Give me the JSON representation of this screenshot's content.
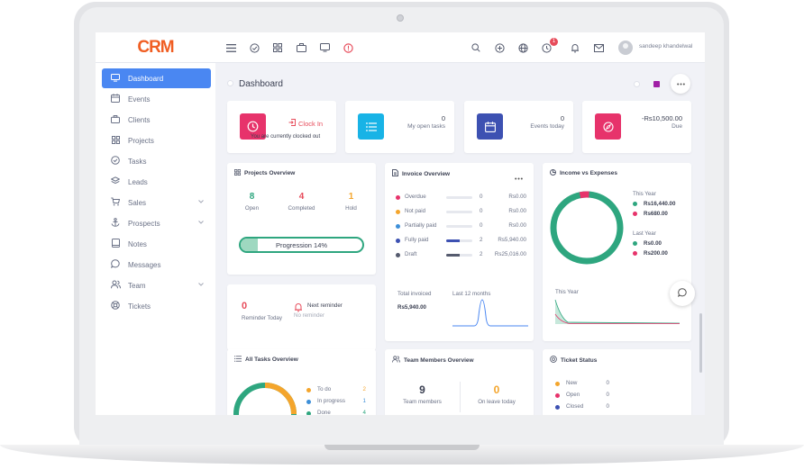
{
  "colors": {
    "accent": "#4a87f2",
    "brand": "#f05e23",
    "pink": "#e7336b",
    "cyan": "#18b3e6",
    "indigo": "#3d51b2",
    "green": "#2ea67f",
    "orange": "#f4a52c",
    "red": "#e74c5b"
  },
  "topbar": {
    "logo": "CRM",
    "icons": [
      "menu-icon",
      "check-circle-icon",
      "grid-icon",
      "briefcase-icon",
      "monitor-icon",
      "alert-icon"
    ],
    "right_icons": [
      "search-icon",
      "plus-circle-icon",
      "globe-icon",
      "clock-icon",
      "bell-icon",
      "mail-icon"
    ],
    "notification_count": "1",
    "user_name": "sandeep khandelwal"
  },
  "sidebar": {
    "items": [
      {
        "label": "Dashboard",
        "icon": "monitor-icon",
        "active": true
      },
      {
        "label": "Events",
        "icon": "calendar-icon"
      },
      {
        "label": "Clients",
        "icon": "briefcase-icon"
      },
      {
        "label": "Projects",
        "icon": "grid-icon"
      },
      {
        "label": "Tasks",
        "icon": "check-circle-icon"
      },
      {
        "label": "Leads",
        "icon": "layers-icon"
      },
      {
        "label": "Sales",
        "icon": "cart-icon",
        "expandable": true
      },
      {
        "label": "Prospects",
        "icon": "anchor-icon",
        "expandable": true
      },
      {
        "label": "Notes",
        "icon": "book-icon"
      },
      {
        "label": "Messages",
        "icon": "message-icon"
      },
      {
        "label": "Team",
        "icon": "users-icon",
        "expandable": true
      },
      {
        "label": "Tickets",
        "icon": "lifebuoy-icon"
      }
    ]
  },
  "page": {
    "title": "Dashboard"
  },
  "tiles": {
    "clock": {
      "action": "Clock In",
      "status": "You are currently clocked out"
    },
    "tasks": {
      "value": "0",
      "label": "My open tasks"
    },
    "events": {
      "value": "0",
      "label": "Events today"
    },
    "due": {
      "value": "-Rs10,500.00",
      "label": "Due"
    }
  },
  "projects_overview": {
    "title": "Projects Overview",
    "stats": [
      {
        "value": "8",
        "label": "Open",
        "color": "#2ea67f"
      },
      {
        "value": "4",
        "label": "Completed",
        "color": "#e74c5b"
      },
      {
        "value": "1",
        "label": "Hold",
        "color": "#f4a52c"
      }
    ],
    "progression_label": "Progression 14%",
    "progression": 0.14
  },
  "reminder": {
    "value": "0",
    "label": "Reminder Today",
    "next_title": "Next reminder",
    "next_value": "No reminder"
  },
  "invoice_overview": {
    "title": "Invoice Overview",
    "rows": [
      {
        "label": "Overdue",
        "count": "0",
        "amount": "Rs0.00",
        "color": "#e7336b",
        "fill": 0
      },
      {
        "label": "Not paid",
        "count": "0",
        "amount": "Rs0.00",
        "color": "#f4a52c",
        "fill": 0
      },
      {
        "label": "Partially paid",
        "count": "0",
        "amount": "Rs0.00",
        "color": "#3d8fd8",
        "fill": 0
      },
      {
        "label": "Fully paid",
        "count": "2",
        "amount": "Rs5,940.00",
        "color": "#3d51b2",
        "fill": 0.5
      },
      {
        "label": "Draft",
        "count": "2",
        "amount": "Rs25,016.00",
        "color": "#555b6e",
        "fill": 0.5
      }
    ],
    "invoiced_label": "Total invoiced",
    "invoiced_value": "Rs5,940.00",
    "period_label": "Last 12 months"
  },
  "income_expenses": {
    "title": "Income vs Expenses",
    "this_year_label": "This Year",
    "this_year": [
      {
        "value": "Rs16,440.00",
        "color": "#2ea67f"
      },
      {
        "value": "Rs680.00",
        "color": "#e7336b"
      }
    ],
    "last_year_label": "Last Year",
    "last_year": [
      {
        "value": "Rs0.00",
        "color": "#2ea67f"
      },
      {
        "value": "Rs200.00",
        "color": "#e7336b"
      }
    ],
    "chart_label": "This Year"
  },
  "all_tasks": {
    "title": "All Tasks Overview",
    "rows": [
      {
        "label": "To do",
        "count": "2",
        "color": "#f4a52c"
      },
      {
        "label": "In progress",
        "count": "1",
        "color": "#3d8fd8"
      },
      {
        "label": "Done",
        "count": "4",
        "color": "#2ea67f"
      }
    ]
  },
  "team_overview": {
    "title": "Team Members Overview",
    "members_value": "9",
    "members_label": "Team members",
    "leave_value": "0",
    "leave_label": "On leave today"
  },
  "ticket_status": {
    "title": "Ticket Status",
    "rows": [
      {
        "label": "New",
        "count": "0",
        "color": "#f4a52c"
      },
      {
        "label": "Open",
        "count": "0",
        "color": "#e7336b"
      },
      {
        "label": "Closed",
        "count": "0",
        "color": "#3d51b2"
      }
    ]
  }
}
